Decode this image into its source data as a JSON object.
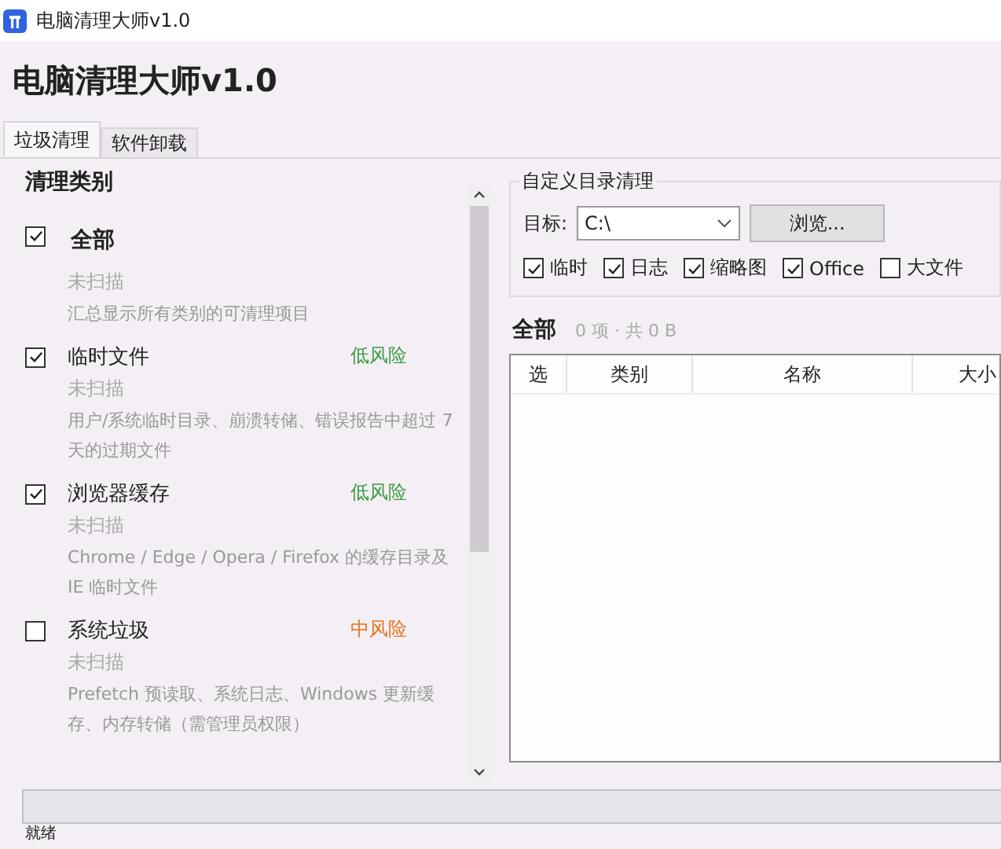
{
  "window": {
    "title": "电脑清理大师v1.0"
  },
  "app_title": "电脑清理大师v1.0",
  "tabs": [
    {
      "label": "垃圾清理",
      "selected": true
    },
    {
      "label": "软件卸载",
      "selected": false
    }
  ],
  "categories": {
    "heading": "清理类别",
    "items": [
      {
        "kind": "summary",
        "name": "全部",
        "checked": true,
        "status": "未扫描",
        "description": "汇总显示所有类别的可清理项目"
      },
      {
        "kind": "category",
        "name": "临时文件",
        "checked": true,
        "risk": "低风险",
        "color": "#3f9a45",
        "status": "未扫描",
        "description": "用户/系统临时目录、崩溃转储、错误报告中超过 7 天的过期文件"
      },
      {
        "kind": "category",
        "name": "浏览器缓存",
        "checked": true,
        "risk": "低风险",
        "color": "#3f9a45",
        "status": "未扫描",
        "description": "Chrome / Edge / Opera / Firefox 的缓存目录及 IE 临时文件"
      },
      {
        "kind": "category",
        "name": "系统垃圾",
        "checked": false,
        "risk": "中风险",
        "color": "#e8731c",
        "status": "未扫描",
        "description": "Prefetch 预读取、系统日志、Windows 更新缓存、内存转储（需管理员权限）"
      }
    ]
  },
  "custom_dir": {
    "title": "自定义目录清理",
    "target_label": "目标:",
    "target_value": "C:\\",
    "browse_button": "浏览...",
    "options": [
      {
        "label": "临时",
        "checked": true
      },
      {
        "label": "日志",
        "checked": true
      },
      {
        "label": "缩略图",
        "checked": true
      },
      {
        "label": "Office",
        "checked": true
      },
      {
        "label": "大文件",
        "checked": false
      }
    ]
  },
  "results": {
    "title": "全部",
    "summary": "0 项 · 共 0 B",
    "table": {
      "columns": [
        "选",
        "类别",
        "名称",
        "大小"
      ]
    }
  },
  "progress": {
    "level": 0
  },
  "status_bar": "就绪"
}
